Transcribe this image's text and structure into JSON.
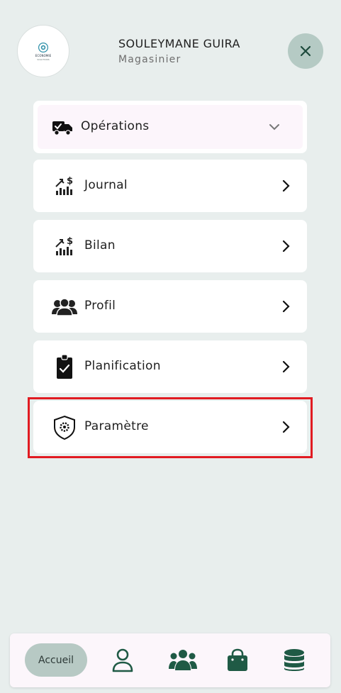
{
  "header": {
    "user_name": "SOULEYMANE GUIRA",
    "user_role": "Magasinier",
    "logo_text": "ECONOMIE",
    "logo_subtext": "SOLUTIONS",
    "close_icon": "close-icon"
  },
  "menu": {
    "operations": {
      "label": "Opérations",
      "icon": "truck-check-icon",
      "chevron": "chevron-down-icon"
    },
    "items": [
      {
        "label": "Journal",
        "icon": "finance-chart-icon"
      },
      {
        "label": "Bilan",
        "icon": "finance-chart-icon"
      },
      {
        "label": "Profil",
        "icon": "users-group-icon"
      },
      {
        "label": "Planification",
        "icon": "clipboard-check-icon"
      },
      {
        "label": "Paramètre",
        "icon": "shield-gear-icon"
      }
    ]
  },
  "bottom_nav": {
    "home_label": "Accueil",
    "icons": [
      "user-icon",
      "team-icon",
      "shopping-bag-icon",
      "database-icon"
    ]
  },
  "colors": {
    "background": "#e8eeed",
    "accent": "#1f5a45",
    "highlight": "#e11b22",
    "close_bg": "#b5cac4"
  }
}
